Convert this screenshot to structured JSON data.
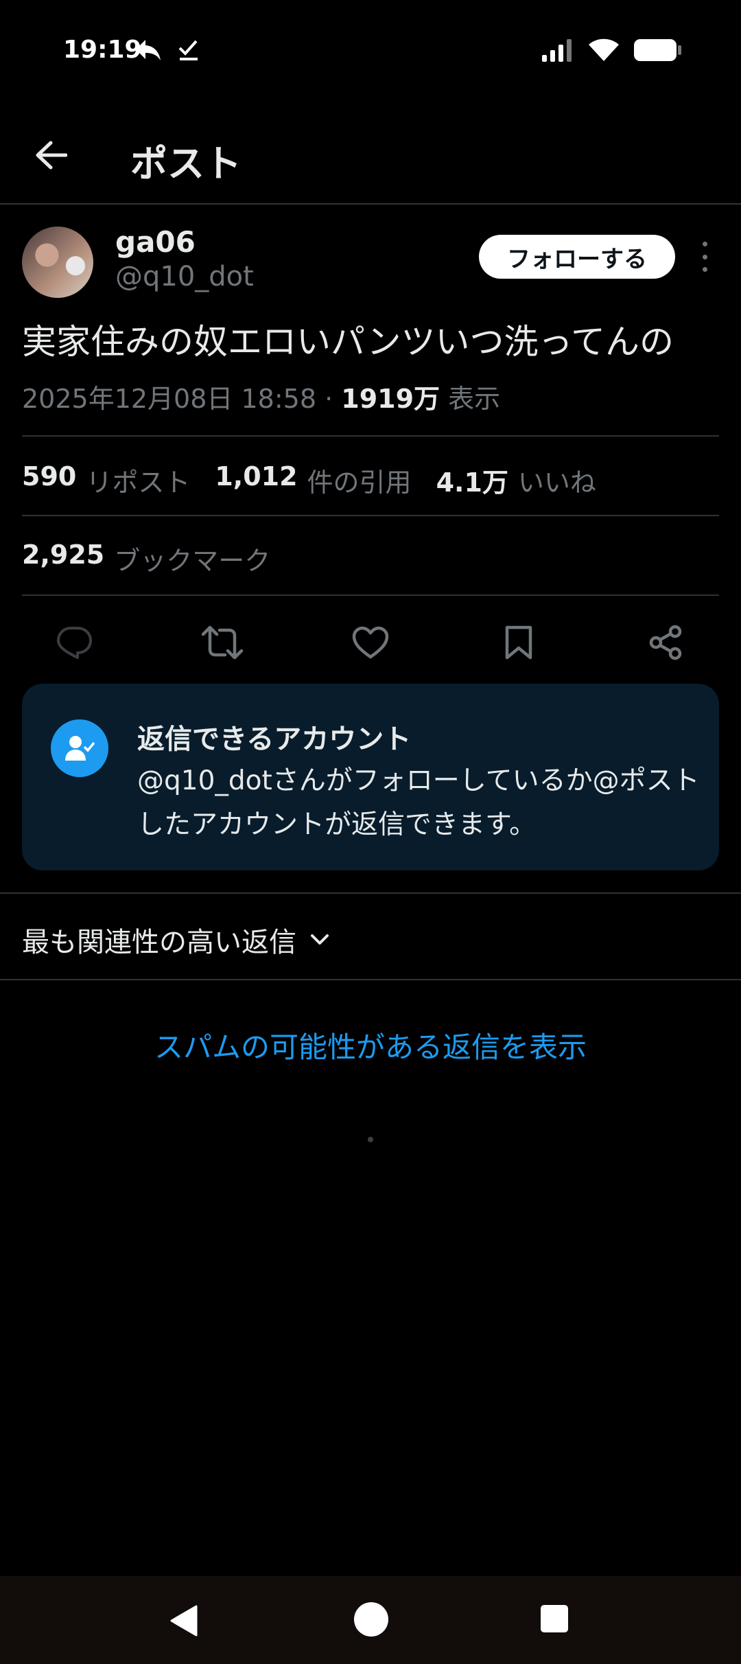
{
  "status_bar": {
    "time": "19:19",
    "icons_left": [
      "reply-arrow-icon",
      "check-download-icon"
    ],
    "icons_right": [
      "signal-icon",
      "wifi-icon",
      "battery-icon"
    ]
  },
  "header": {
    "title": "ポスト",
    "back_icon": "arrow-left-icon"
  },
  "author": {
    "name": "ga06",
    "handle": "@q10_dot",
    "follow_label": "フォローする"
  },
  "post": {
    "text": "実家住みの奴エロいパンツいつ洗ってんの",
    "date": "2025年12月08日 18:58",
    "separator": "·",
    "views_count": "1919万",
    "views_label": "表示"
  },
  "stats": {
    "reposts_count": "590",
    "reposts_label": "リポスト",
    "quotes_count": "1,012",
    "quotes_label": "件の引用",
    "likes_count": "4.1万",
    "likes_label": "いいね",
    "bookmarks_count": "2,925",
    "bookmarks_label": "ブックマーク"
  },
  "actions": [
    "reply-icon",
    "repost-icon",
    "like-icon",
    "bookmark-icon",
    "share-icon"
  ],
  "reply_restriction": {
    "title": "返信できるアカウント",
    "body": "@q10_dotさんがフォローしているか@ポストしたアカウントが返信できます。"
  },
  "replies": {
    "sort_label": "最も関連性の高い返信",
    "spam_link": "スパムの可能性がある返信を表示"
  },
  "colors": {
    "background": "#000000",
    "accent": "#1d9bf0",
    "muted_text": "#71767b",
    "card_bg": "#081c2b"
  }
}
